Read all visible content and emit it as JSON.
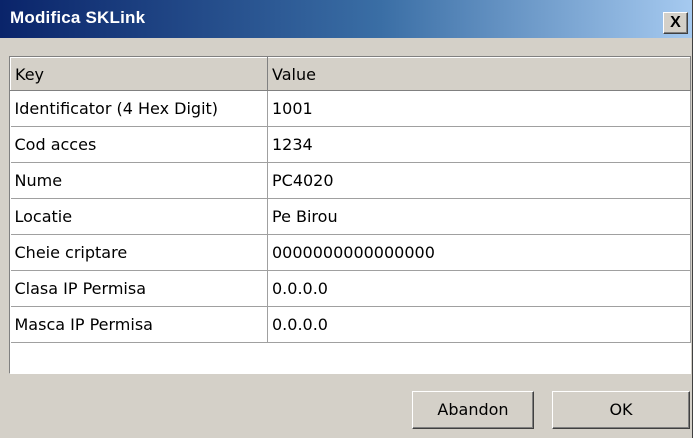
{
  "window": {
    "title": "Modifica SKLink",
    "close_glyph": "X",
    "close_icon": "close-icon"
  },
  "grid": {
    "columns": [
      "Key",
      "Value"
    ],
    "rows": [
      {
        "key": "Identificator (4 Hex Digit)",
        "value": "1001"
      },
      {
        "key": "Cod acces",
        "value": "1234"
      },
      {
        "key": "Nume",
        "value": "PC4020"
      },
      {
        "key": "Locatie",
        "value": "Pe Birou"
      },
      {
        "key": "Cheie criptare",
        "value": "0000000000000000"
      },
      {
        "key": "Clasa IP Permisa",
        "value": "0.0.0.0"
      },
      {
        "key": "Masca IP Permisa",
        "value": "0.0.0.0"
      }
    ]
  },
  "buttons": {
    "abandon_label": "Abandon",
    "ok_label": "OK"
  },
  "colors": {
    "titlebar_start": "#0a246a",
    "titlebar_end": "#a6caf0",
    "face": "#d4d0c8"
  }
}
